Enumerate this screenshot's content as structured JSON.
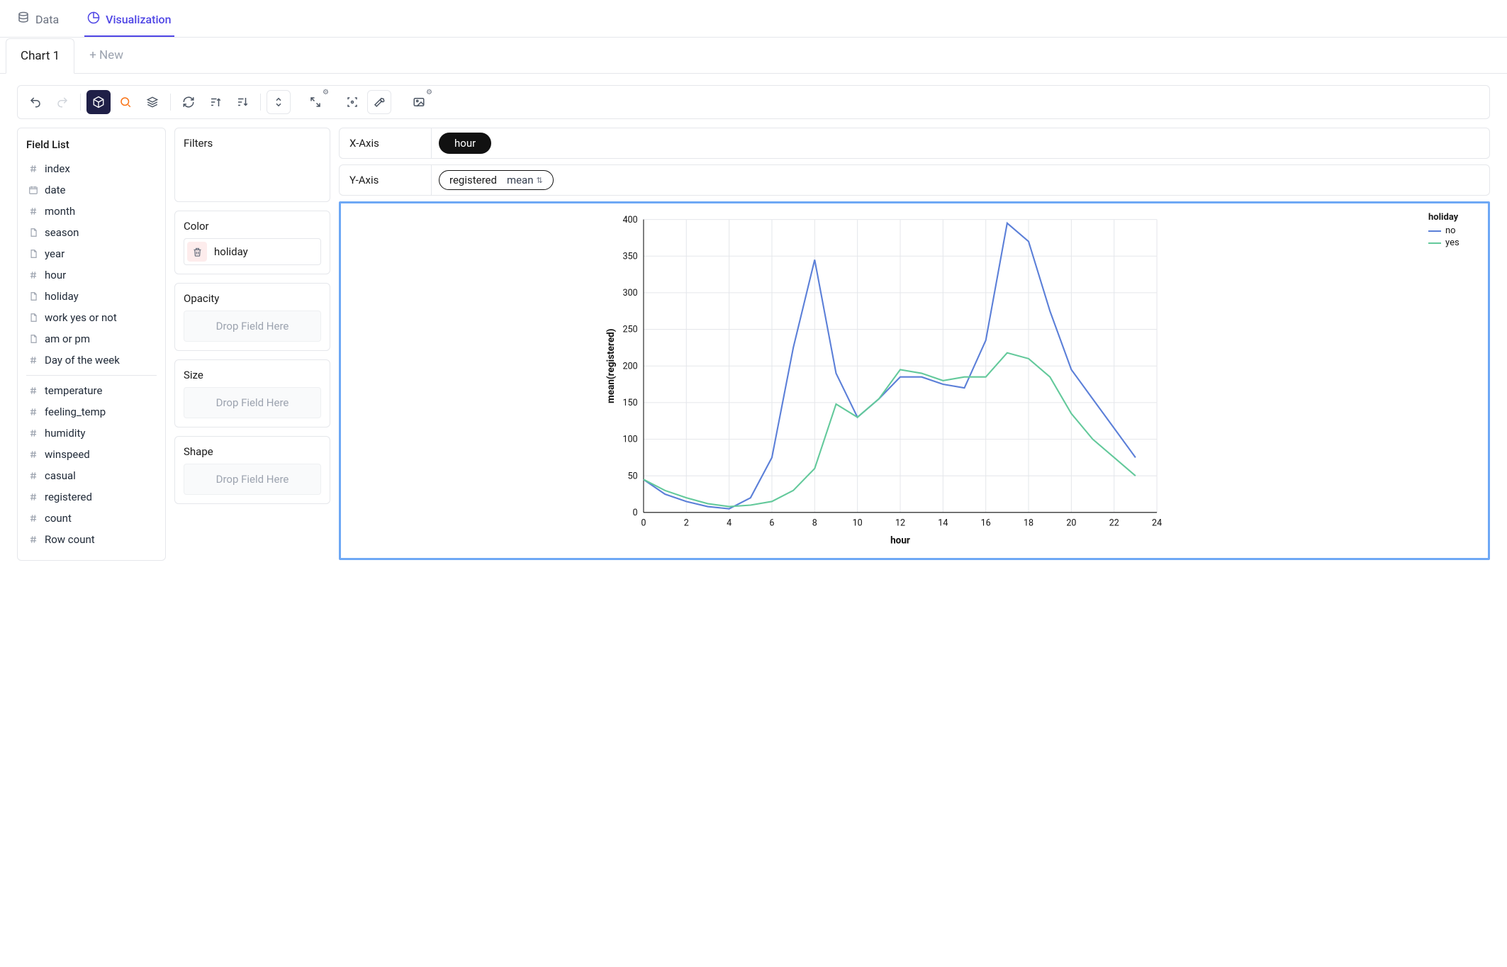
{
  "top_nav": {
    "data_label": "Data",
    "visualization_label": "Visualization"
  },
  "chart_tabs": {
    "tab1_label": "Chart 1",
    "new_label": "+ New"
  },
  "field_list": {
    "title": "Field List",
    "items": [
      {
        "icon": "hash",
        "label": "index"
      },
      {
        "icon": "calendar",
        "label": "date"
      },
      {
        "icon": "hash",
        "label": "month"
      },
      {
        "icon": "doc",
        "label": "season"
      },
      {
        "icon": "doc",
        "label": "year"
      },
      {
        "icon": "hash",
        "label": "hour"
      },
      {
        "icon": "doc",
        "label": "holiday"
      },
      {
        "icon": "doc",
        "label": "work yes or not"
      },
      {
        "icon": "doc",
        "label": "am or pm"
      },
      {
        "icon": "hash",
        "label": "Day of the week"
      }
    ],
    "items2": [
      {
        "icon": "hash",
        "label": "temperature"
      },
      {
        "icon": "hash",
        "label": "feeling_temp"
      },
      {
        "icon": "hash",
        "label": "humidity"
      },
      {
        "icon": "hash",
        "label": "winspeed"
      },
      {
        "icon": "hash",
        "label": "casual"
      },
      {
        "icon": "hash",
        "label": "registered"
      },
      {
        "icon": "hash",
        "label": "count"
      },
      {
        "icon": "hash",
        "label": "Row count"
      }
    ]
  },
  "encodings": {
    "filters_title": "Filters",
    "color_title": "Color",
    "color_value": "holiday",
    "opacity_title": "Opacity",
    "size_title": "Size",
    "shape_title": "Shape",
    "drop_label": "Drop Field Here"
  },
  "axes": {
    "x_label": "X-Axis",
    "x_value": "hour",
    "y_label": "Y-Axis",
    "y_value": "registered",
    "y_agg": "mean"
  },
  "chart_data": {
    "type": "line",
    "title": "",
    "xlabel": "hour",
    "ylabel": "mean(registered)",
    "legend_title": "holiday",
    "x": [
      0,
      1,
      2,
      3,
      4,
      5,
      6,
      7,
      8,
      9,
      10,
      11,
      12,
      13,
      14,
      15,
      16,
      17,
      18,
      19,
      20,
      21,
      22,
      23
    ],
    "xlim": [
      0,
      24
    ],
    "ylim": [
      0,
      400
    ],
    "xticks": [
      0,
      2,
      4,
      6,
      8,
      10,
      12,
      14,
      16,
      18,
      20,
      22,
      24
    ],
    "yticks": [
      0,
      50,
      100,
      150,
      200,
      250,
      300,
      350,
      400
    ],
    "series": [
      {
        "name": "no",
        "color": "#5b7fd8",
        "values": [
          45,
          25,
          15,
          8,
          5,
          20,
          75,
          225,
          345,
          190,
          130,
          155,
          185,
          185,
          175,
          170,
          235,
          395,
          370,
          275,
          195,
          155,
          115,
          75
        ]
      },
      {
        "name": "yes",
        "color": "#63c99b",
        "values": [
          45,
          30,
          20,
          12,
          8,
          10,
          15,
          30,
          60,
          148,
          130,
          155,
          195,
          190,
          180,
          185,
          185,
          218,
          210,
          185,
          135,
          100,
          75,
          50
        ]
      }
    ]
  }
}
